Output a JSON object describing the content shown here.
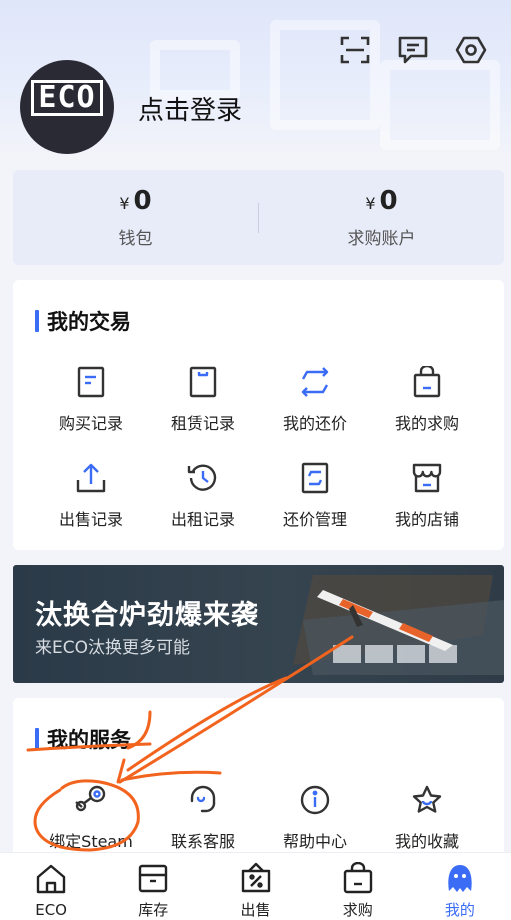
{
  "header": {
    "avatar_text": "ECO",
    "login_text": "点击登录"
  },
  "wallet": {
    "currency": "¥",
    "items": [
      {
        "amount": "0",
        "label": "钱包"
      },
      {
        "amount": "0",
        "label": "求购账户"
      }
    ]
  },
  "trade": {
    "title": "我的交易",
    "items": [
      {
        "label": "购买记录",
        "icon": "purchase-record-icon"
      },
      {
        "label": "租赁记录",
        "icon": "lease-record-icon"
      },
      {
        "label": "我的还价",
        "icon": "counter-offer-icon"
      },
      {
        "label": "我的求购",
        "icon": "buy-request-icon"
      },
      {
        "label": "出售记录",
        "icon": "sale-record-icon"
      },
      {
        "label": "出租记录",
        "icon": "rent-out-record-icon"
      },
      {
        "label": "还价管理",
        "icon": "offer-management-icon"
      },
      {
        "label": "我的店铺",
        "icon": "store-icon"
      }
    ]
  },
  "banner": {
    "title": "汰换合炉劲爆来袭",
    "subtitle": "来ECO汰换更多可能"
  },
  "services": {
    "title": "我的服务",
    "items": [
      {
        "label": "绑定Steam",
        "icon": "steam-icon"
      },
      {
        "label": "联系客服",
        "icon": "customer-service-icon"
      },
      {
        "label": "帮助中心",
        "icon": "info-icon"
      },
      {
        "label": "我的收藏",
        "icon": "star-icon"
      }
    ]
  },
  "tabbar": {
    "items": [
      {
        "label": "ECO",
        "icon": "home-icon"
      },
      {
        "label": "库存",
        "icon": "inventory-icon"
      },
      {
        "label": "出售",
        "icon": "sell-icon"
      },
      {
        "label": "求购",
        "icon": "buy-icon"
      },
      {
        "label": "我的",
        "icon": "profile-icon",
        "active": true
      }
    ]
  },
  "colors": {
    "accent": "#3b6cf6",
    "annotation": "#f2641e"
  }
}
